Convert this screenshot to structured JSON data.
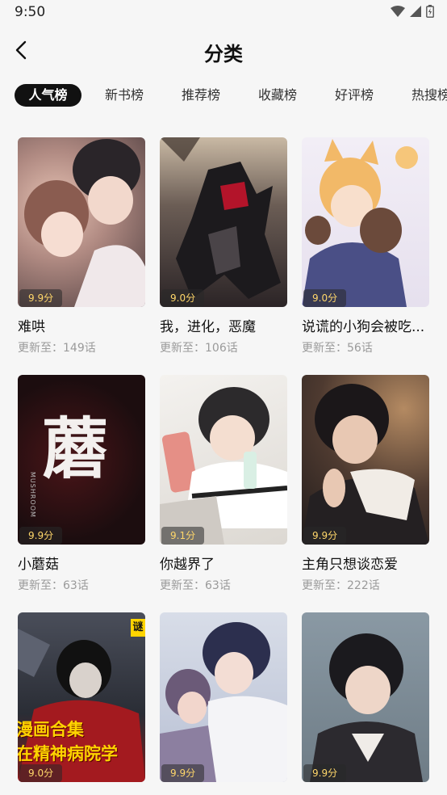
{
  "status": {
    "time": "9:50"
  },
  "header": {
    "title": "分类"
  },
  "tabs": [
    "人气榜",
    "新书榜",
    "推荐榜",
    "收藏榜",
    "好评榜",
    "热搜榜"
  ],
  "active_tab": 0,
  "colors": {
    "active_tab_bg": "#111111",
    "rating_text": "#ffd76a",
    "subtitle": "#9a9a9a",
    "background": "#f6f6f6"
  },
  "cards": [
    {
      "title": "难哄",
      "updated": "更新至：149话",
      "rating": "9.9分"
    },
    {
      "title": "我，进化，恶魔",
      "updated": "更新至：106话",
      "rating": "9.0分"
    },
    {
      "title": "说谎的小狗会被吃...",
      "updated": "更新至：56话",
      "rating": "9.0分"
    },
    {
      "title": "小蘑菇",
      "updated": "更新至：63话",
      "rating": "9.9分",
      "cover_text": "蘑",
      "cover_subtext": "MUSHROOM"
    },
    {
      "title": "你越界了",
      "updated": "更新至：63话",
      "rating": "9.1分"
    },
    {
      "title": "主角只想谈恋爱",
      "updated": "更新至：222话",
      "rating": "9.9分"
    },
    {
      "title": "",
      "updated": "",
      "rating": "9.0分",
      "cover_text": "漫画合集\n在精神病院学",
      "corner_badge": "谜"
    },
    {
      "title": "",
      "updated": "",
      "rating": "9.9分"
    },
    {
      "title": "",
      "updated": "",
      "rating": "9.9分"
    }
  ]
}
